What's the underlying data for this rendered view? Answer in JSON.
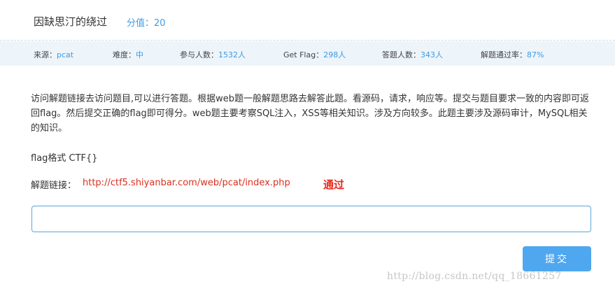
{
  "header": {
    "title": "因缺思汀的绕过",
    "score": "分值：20"
  },
  "stats": {
    "source_label": "来源：",
    "source_value": "pcat",
    "difficulty_label": "难度：",
    "difficulty_value": "中",
    "participants_label": "参与人数：",
    "participants_value": "1532人",
    "getflag_label": "Get Flag：",
    "getflag_value": "298人",
    "answers_label": "答题人数：",
    "answers_value": "343人",
    "passrate_label": "解题通过率：",
    "passrate_value": "87%"
  },
  "content": {
    "description": "访问解题链接去访问题目,可以进行答题。根据web题一般解题思路去解答此题。看源码，请求，响应等。提交与题目要求一致的内容即可返回flag。然后提交正确的flag即可得分。web题主要考察SQL注入，XSS等相关知识。涉及方向较多。此题主要涉及源码审计，MySQL相关的知识。",
    "flag_format": "flag格式 CTF{}",
    "link_label": "解题链接：",
    "link_url": "http://ctf5.shiyanbar.com/web/pcat/index.php",
    "pass_label": "通过"
  },
  "form": {
    "flag_value": "",
    "submit_label": "提交"
  },
  "watermark": "http://blog.csdn.net/qq_18661257",
  "colors": {
    "accent": "#3d9be0",
    "stats_bg": "#edf4fa",
    "link": "#d9301f",
    "pass": "#e8261a",
    "button": "#4fa7ef"
  }
}
